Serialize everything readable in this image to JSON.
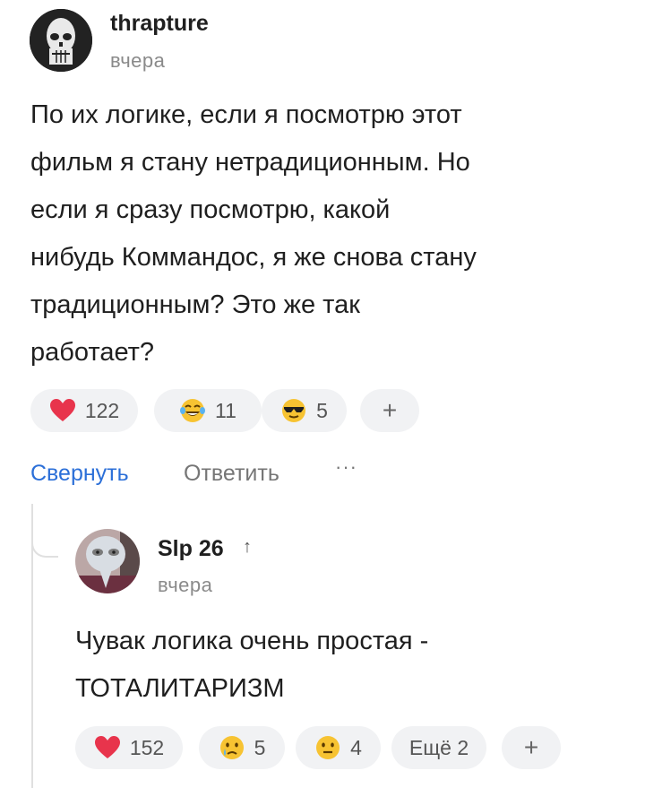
{
  "comment": {
    "author": "thrapture",
    "time": "вчера",
    "lines": [
      "По их логике, если я посмотрю этот",
      "фильм я стану нетрадиционным. Но",
      "если я сразу посмотрю, какой",
      "нибудь Коммандос, я же снова стану",
      "традиционным? Это же так",
      "работает?"
    ],
    "reactions": [
      {
        "icon": "heart",
        "count": "122"
      },
      {
        "icon": "tears-of-joy",
        "count": "11"
      },
      {
        "icon": "sunglasses",
        "count": "5"
      }
    ],
    "add_label": "+",
    "actions": {
      "collapse": "Свернуть",
      "reply": "Ответить",
      "more": "···"
    }
  },
  "reply": {
    "author": "Slp 26",
    "up_arrow": "↑",
    "time": "вчера",
    "lines": [
      "Чувак логика очень простая -",
      "ТОТАЛИТАРИЗМ"
    ],
    "reactions": [
      {
        "icon": "heart",
        "count": "152"
      },
      {
        "icon": "crying-face",
        "count": "5"
      },
      {
        "icon": "neutral-face",
        "count": "4"
      }
    ],
    "more_label": "Ещё 2",
    "add_label": "+"
  },
  "colors": {
    "accent": "#2b6fd8",
    "heart": "#e8344c",
    "pill": "#f1f2f4",
    "emoji": "#f7c332"
  }
}
